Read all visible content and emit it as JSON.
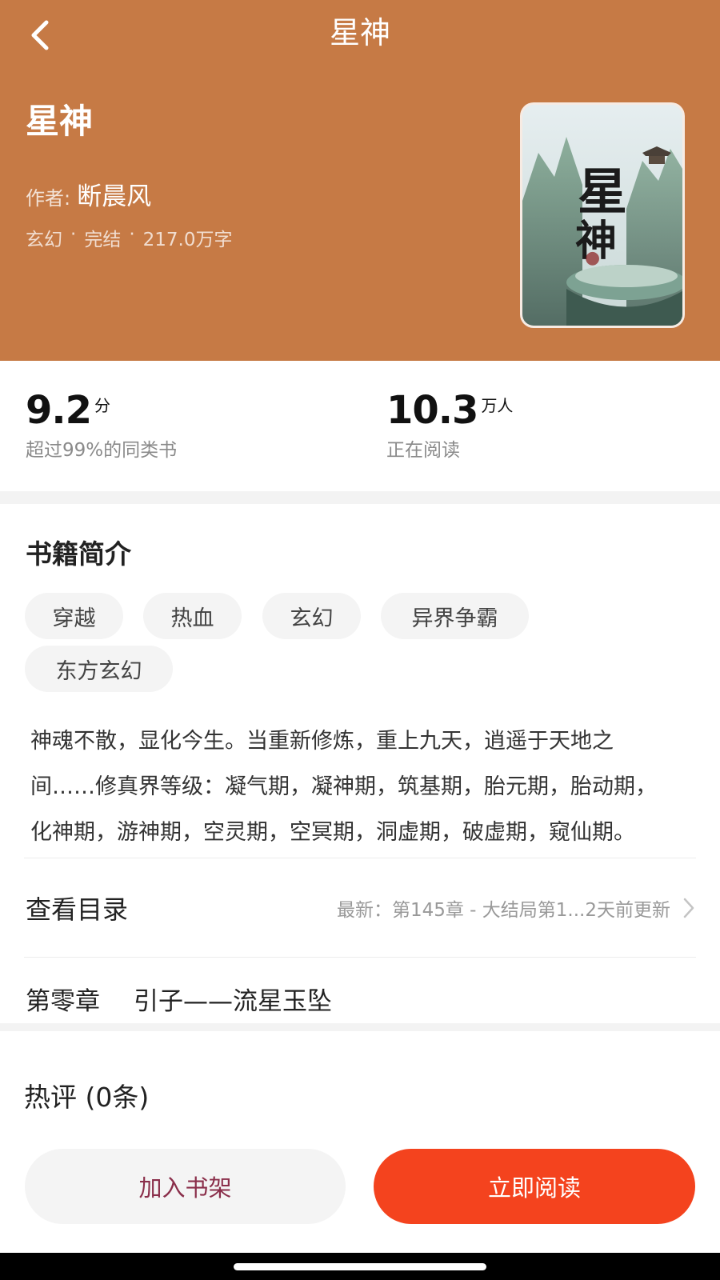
{
  "header": {
    "back_icon": "chevron-left-icon",
    "nav_title": "星神"
  },
  "book": {
    "title": "星神",
    "author_label": "作者:",
    "author_name": "断晨风",
    "genre": "玄幻",
    "separator": "·",
    "status": "完结",
    "word_count": "217.0万字",
    "cover_text": "星神"
  },
  "stats": {
    "score_value": "9.2",
    "score_unit": "分",
    "score_desc": "超过99%的同类书",
    "readers_value": "10.3",
    "readers_unit": "万人",
    "readers_desc": "正在阅读"
  },
  "intro": {
    "title": "书籍简介",
    "tags": [
      "穿越",
      "热血",
      "玄幻",
      "异界争霸",
      "东方玄幻"
    ],
    "description_lines": [
      "神魂不散，显化今生。当重新修炼，重上九天，逍遥于天地之",
      "间……修真界等级：凝气期，凝神期，筑基期，胎元期，胎动期，",
      "化神期，游神期，空灵期，空冥期，洞虚期，破虚期，窥仙期。"
    ]
  },
  "catalog": {
    "title": "查看目录",
    "latest": "最新：第145章 - 大结局第1...2天前更新",
    "arrow_icon": "chevron-right-icon"
  },
  "first_chapter": {
    "number": "第零章",
    "name": "引子——流星玉坠"
  },
  "comments": {
    "title": "热评 (0条)"
  },
  "actions": {
    "add_shelf": "加入书架",
    "read_now": "立即阅读"
  },
  "colors": {
    "header_bg": "#c67a45",
    "primary_button": "#f4431e",
    "shelf_text": "#8a2e4a"
  }
}
